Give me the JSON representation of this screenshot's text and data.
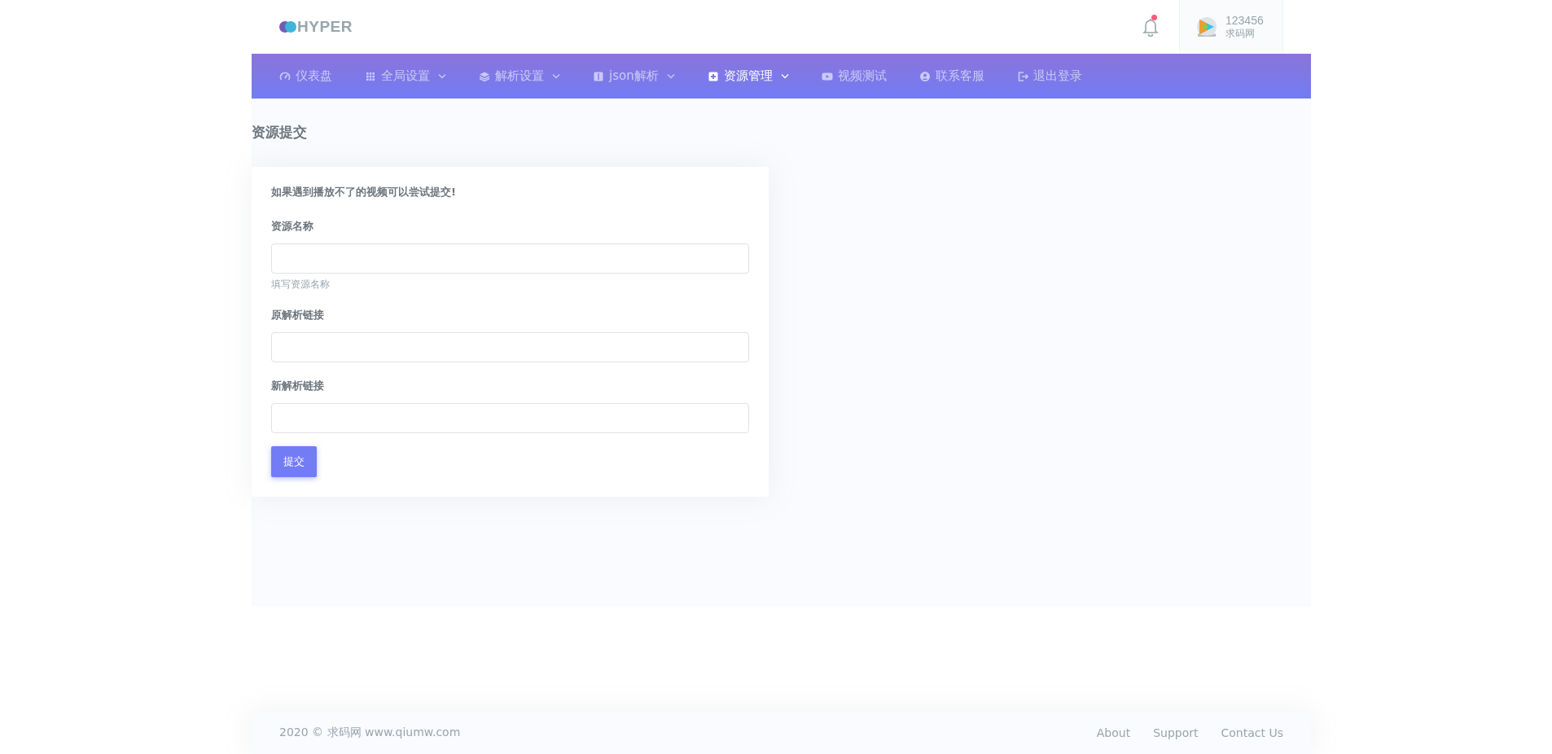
{
  "header": {
    "logo_text": "HYPER",
    "notification": {
      "unread": true
    },
    "user": {
      "name": "123456",
      "subtitle": "求码网"
    }
  },
  "nav": [
    {
      "label": "仪表盘",
      "kind": "gauge",
      "dropdown": false,
      "selected": false
    },
    {
      "label": "全局设置",
      "kind": "grid",
      "dropdown": true,
      "selected": false
    },
    {
      "label": "解析设置",
      "kind": "layers",
      "dropdown": true,
      "selected": false
    },
    {
      "label": "json解析",
      "kind": "book",
      "dropdown": true,
      "selected": false
    },
    {
      "label": "资源管理",
      "kind": "plus",
      "dropdown": true,
      "selected": true
    },
    {
      "label": "视频测试",
      "kind": "video",
      "dropdown": false,
      "selected": false
    },
    {
      "label": "联系客服",
      "kind": "contact",
      "dropdown": false,
      "selected": false
    },
    {
      "label": "退出登录",
      "kind": "logout",
      "dropdown": false,
      "selected": false
    }
  ],
  "page_title": "资源提交",
  "form": {
    "intro": "如果遇到播放不了的视频可以尝试提交!",
    "fields": [
      {
        "label": "资源名称",
        "help": "填写资源名称"
      },
      {
        "label": "原解析链接"
      },
      {
        "label": "新解析链接"
      }
    ],
    "submit": "提交"
  },
  "footer": {
    "copyright": "2020 © 求码网 www.qiumw.com",
    "links": [
      "About",
      "Support",
      "Contact Us"
    ]
  }
}
